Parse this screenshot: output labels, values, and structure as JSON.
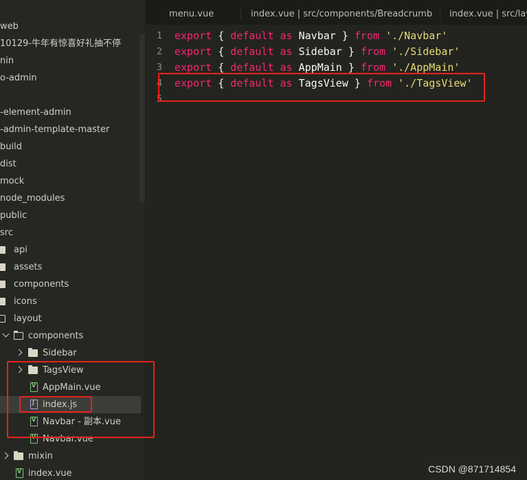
{
  "tabs": [
    {
      "label": "menu.vue"
    },
    {
      "label": "index.vue | src/components/Breadcrumb"
    },
    {
      "label": "index.vue | src/layo"
    }
  ],
  "tree": [
    {
      "label": "web",
      "kind": "text"
    },
    {
      "label": "10129-牛年有惊喜好礼抽不停",
      "kind": "text"
    },
    {
      "label": "nin",
      "kind": "text"
    },
    {
      "label": "o-admin",
      "kind": "text"
    },
    {
      "label": "",
      "kind": "text"
    },
    {
      "label": "-element-admin",
      "kind": "text"
    },
    {
      "label": "-admin-template-master",
      "kind": "text"
    },
    {
      "label": "build",
      "kind": "text"
    },
    {
      "label": "dist",
      "kind": "text"
    },
    {
      "label": "mock",
      "kind": "text"
    },
    {
      "label": "node_modules",
      "kind": "text"
    },
    {
      "label": "public",
      "kind": "text"
    },
    {
      "label": "src",
      "kind": "text"
    },
    {
      "label": "api",
      "kind": "folder"
    },
    {
      "label": "assets",
      "kind": "folder"
    },
    {
      "label": "components",
      "kind": "folder"
    },
    {
      "label": "icons",
      "kind": "folder"
    },
    {
      "label": "layout",
      "kind": "folder-open"
    },
    {
      "label": "components",
      "kind": "folder-open"
    },
    {
      "label": "Sidebar",
      "kind": "folder"
    },
    {
      "label": "TagsView",
      "kind": "folder"
    },
    {
      "label": "AppMain.vue",
      "kind": "vue"
    },
    {
      "label": "index.js",
      "kind": "js"
    },
    {
      "label": "Navbar - 副本.vue",
      "kind": "vue"
    },
    {
      "label": "Navbar.vue",
      "kind": "vue"
    },
    {
      "label": "mixin",
      "kind": "folder"
    },
    {
      "label": "index.vue",
      "kind": "vue"
    }
  ],
  "code": {
    "line_numbers": [
      "1",
      "2",
      "3",
      "4",
      "5"
    ],
    "lines": [
      {
        "kw1": "export",
        "p1": " { ",
        "kw2": "default",
        "p2": " ",
        "kw3": "as",
        "p3": " Navbar } ",
        "kw4": "from",
        "p4": " ",
        "str": "'./Navbar'"
      },
      {
        "kw1": "export",
        "p1": " { ",
        "kw2": "default",
        "p2": " ",
        "kw3": "as",
        "p3": " Sidebar } ",
        "kw4": "from",
        "p4": " ",
        "str": "'./Sidebar'"
      },
      {
        "kw1": "export",
        "p1": " { ",
        "kw2": "default",
        "p2": " ",
        "kw3": "as",
        "p3": " AppMain } ",
        "kw4": "from",
        "p4": " ",
        "str": "'./AppMain'"
      },
      {
        "kw1": "export",
        "p1": " { ",
        "kw2": "default",
        "p2": " ",
        "kw3": "as",
        "p3": " TagsView } ",
        "kw4": "from",
        "p4": " ",
        "str": "'./TagsView'"
      }
    ]
  },
  "watermark": "CSDN @871714854",
  "colors": {
    "keyword": "#f92672",
    "string": "#e6db74",
    "highlight": "#e8221c",
    "background": "#23241f"
  }
}
